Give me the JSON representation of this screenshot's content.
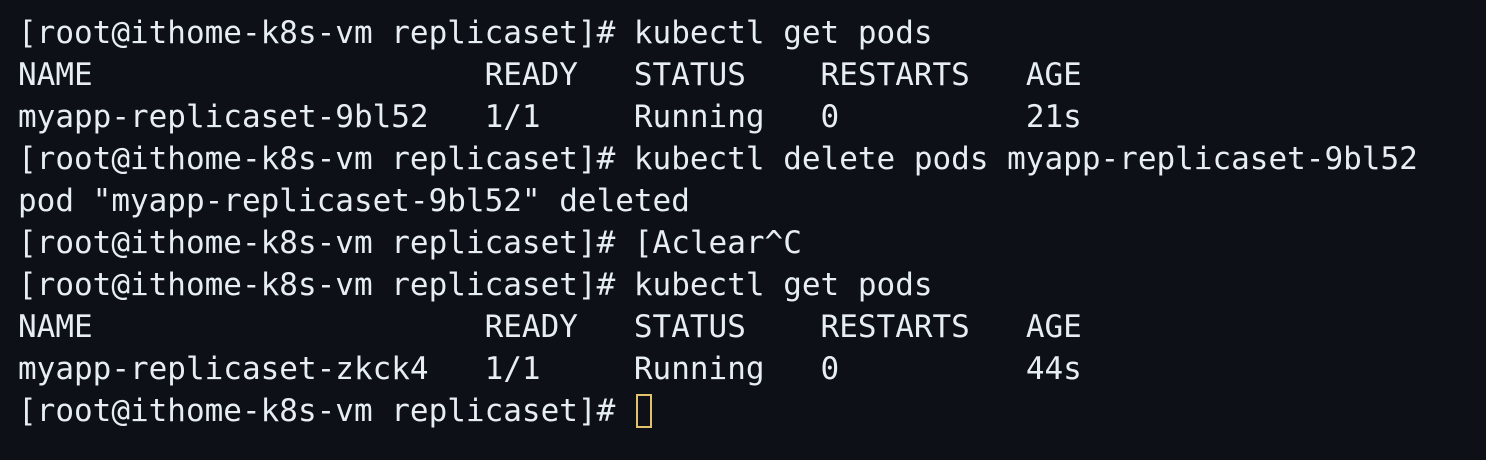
{
  "terminal": {
    "lines": [
      "[root@ithome-k8s-vm replicaset]# kubectl get pods",
      "NAME                     READY   STATUS    RESTARTS   AGE",
      "myapp-replicaset-9bl52   1/1     Running   0          21s",
      "[root@ithome-k8s-vm replicaset]# kubectl delete pods myapp-replicaset-9bl52",
      "pod \"myapp-replicaset-9bl52\" deleted",
      "[root@ithome-k8s-vm replicaset]# [Aclear^C",
      "[root@ithome-k8s-vm replicaset]# kubectl get pods",
      "NAME                     READY   STATUS    RESTARTS   AGE",
      "myapp-replicaset-zkck4   1/1     Running   0          44s",
      "[root@ithome-k8s-vm replicaset]# "
    ],
    "colors": {
      "background": "#0d1117",
      "text": "#e6edf3",
      "cursor": "#e3c26d"
    }
  }
}
